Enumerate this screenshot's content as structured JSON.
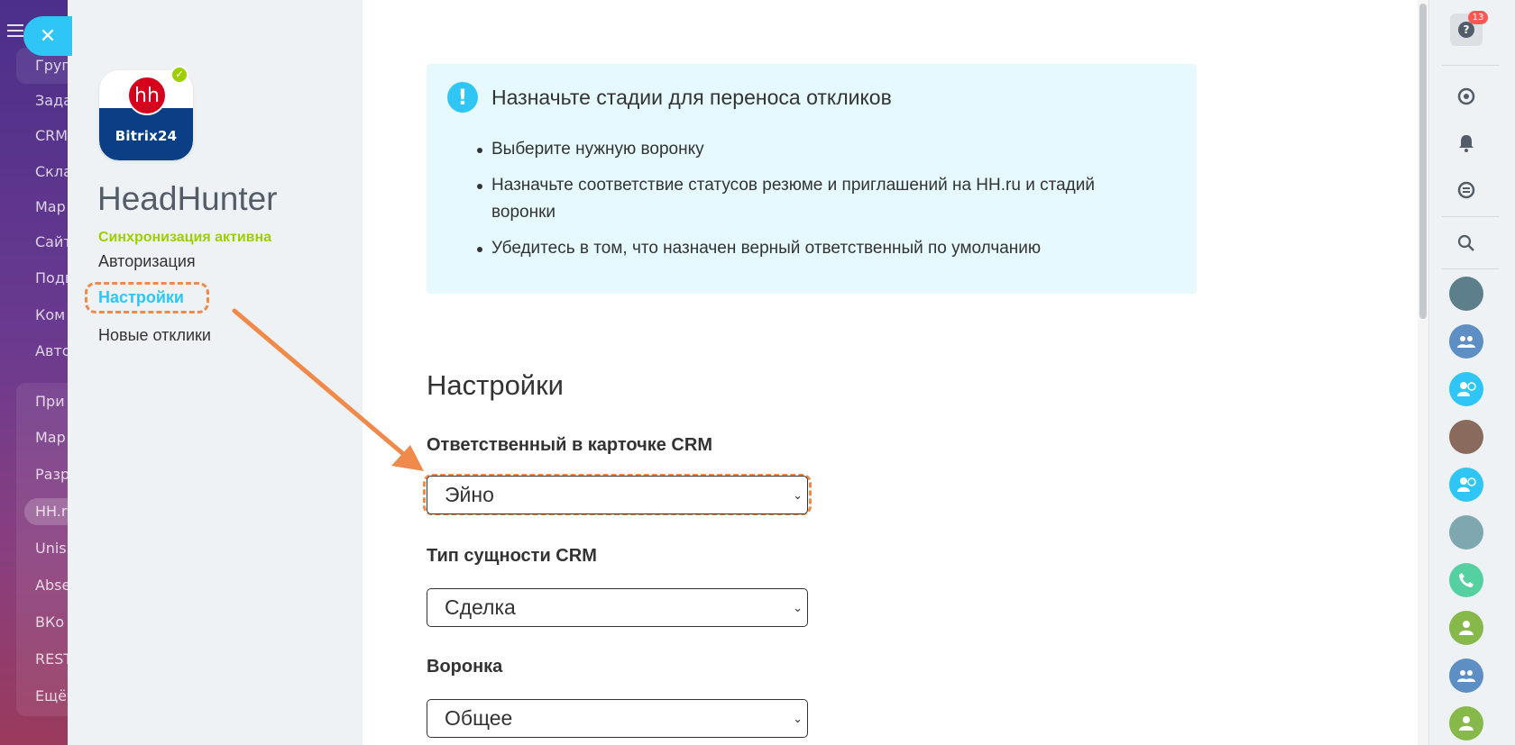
{
  "bitrix_sidebar": {
    "items": [
      "Груп",
      "Зада",
      "CRM",
      "Скла",
      "Мар",
      "Сайт",
      "Подп",
      "Ком",
      "Авто",
      "При",
      "Мар",
      "Разр",
      "HH.r",
      "Unis",
      "Abse",
      "ВКо",
      "REST",
      "Ещё"
    ]
  },
  "app": {
    "logo_mark": "hh",
    "logo_text": "Bitrix24",
    "name": "HeadHunter",
    "sync_status": "Синхронизация активна",
    "nav": {
      "auth": "Авторизация",
      "settings": "Настройки",
      "new_responses": "Новые отклики"
    }
  },
  "info": {
    "icon": "exclamation-icon",
    "title": "Назначьте стадии для переноса откликов",
    "bullets": [
      "Выберите нужную воронку",
      "Назначьте соответствие статусов резюме и приглашений на HH.ru и стадий воронки",
      "Убедитесь в том, что назначен верный ответственный по умолчанию"
    ]
  },
  "settings": {
    "title": "Настройки",
    "responsible_label": "Ответственный в карточке CRM",
    "responsible_value": "Эйно",
    "entity_label": "Тип сущности CRM",
    "entity_value": "Сделка",
    "funnel_label": "Воронка",
    "funnel_value": "Общее"
  },
  "right_panel": {
    "help_count": "13",
    "help_glyph": "?"
  },
  "colors": {
    "accent": "#2fc6f6",
    "sync_green": "#9dcf00",
    "annotation_orange": "#f08a4b",
    "info_bg": "#e5f9ff"
  }
}
